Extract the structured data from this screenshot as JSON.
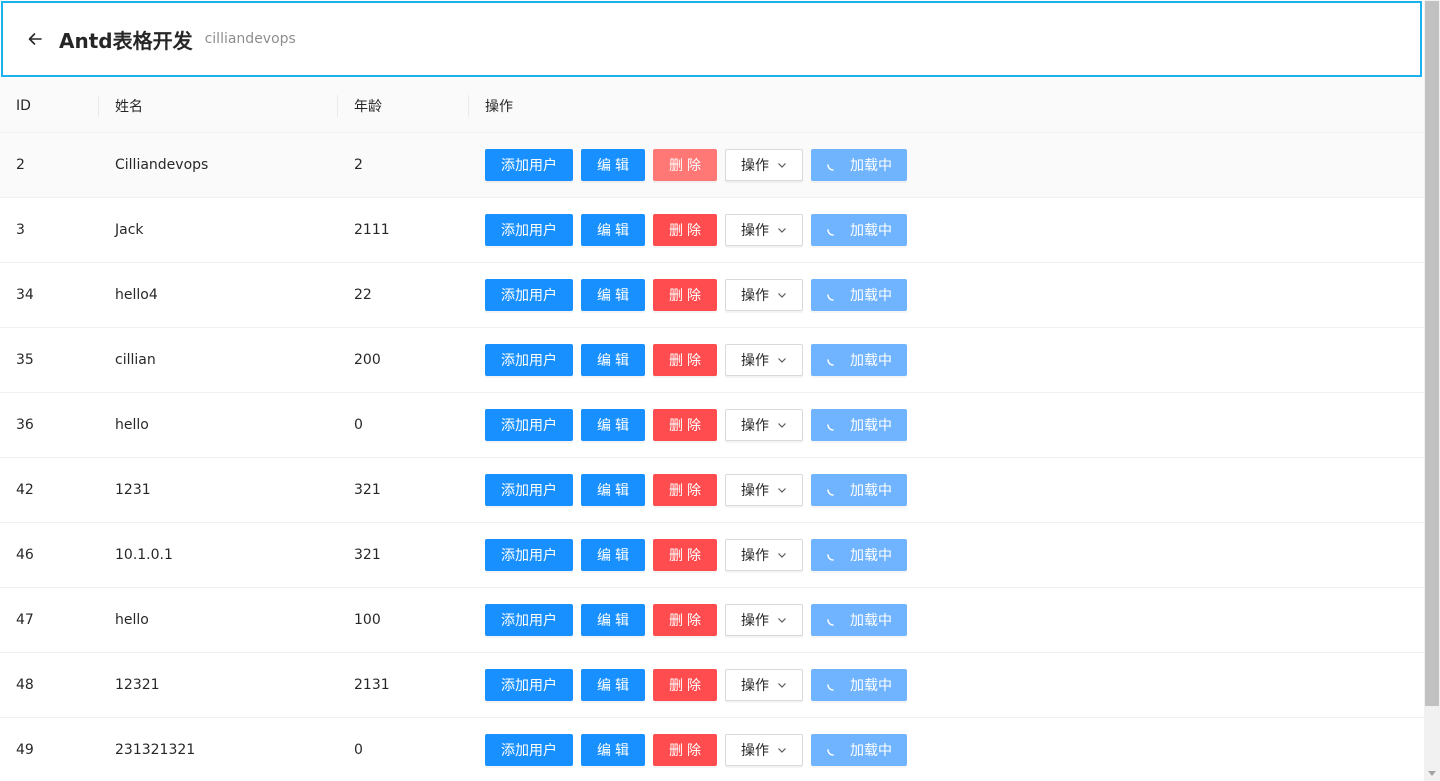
{
  "header": {
    "title": "Antd表格开发",
    "subtitle": "cilliandevops"
  },
  "table": {
    "columns": [
      "ID",
      "姓名",
      "年龄",
      "操作"
    ],
    "rows": [
      {
        "id": "2",
        "name": "Cilliandevops",
        "age": "2"
      },
      {
        "id": "3",
        "name": "Jack",
        "age": "2111"
      },
      {
        "id": "34",
        "name": "hello4",
        "age": "22"
      },
      {
        "id": "35",
        "name": "cillian",
        "age": "200"
      },
      {
        "id": "36",
        "name": "hello",
        "age": "0"
      },
      {
        "id": "42",
        "name": "1231",
        "age": "321"
      },
      {
        "id": "46",
        "name": "10.1.0.1",
        "age": "321"
      },
      {
        "id": "47",
        "name": "hello",
        "age": "100"
      },
      {
        "id": "48",
        "name": "12321",
        "age": "2131"
      },
      {
        "id": "49",
        "name": "231321321",
        "age": "0"
      }
    ]
  },
  "actions": {
    "add_user": "添加用户",
    "edit": "编辑",
    "delete": "删除",
    "more": "操作",
    "loading": "加载中"
  },
  "colors": {
    "primary": "#1890ff",
    "danger": "#ff4d4f",
    "header_border": "#1ab3f0"
  },
  "icons": {
    "back": "arrow-left-icon",
    "dropdown": "chevron-down-icon",
    "loading": "spinner-icon"
  }
}
